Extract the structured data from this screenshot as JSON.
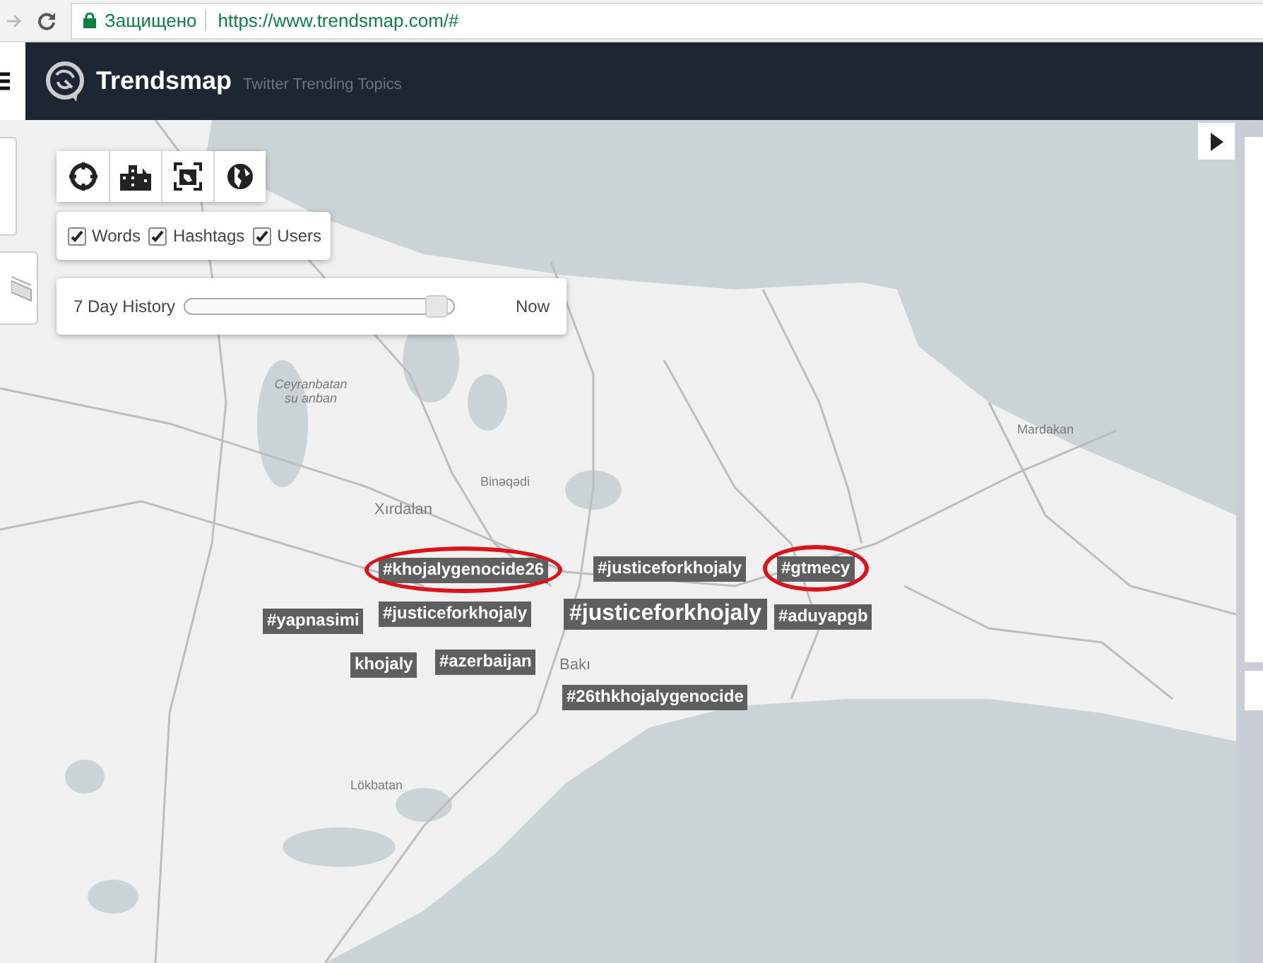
{
  "browser": {
    "security": "Защищено",
    "url": "https://www.trendsmap.com/#"
  },
  "header": {
    "brand": "Trendsmap",
    "tagline": "Twitter Trending Topics"
  },
  "filters": [
    {
      "label": "Words",
      "checked": true
    },
    {
      "label": "Hashtags",
      "checked": true
    },
    {
      "label": "Users",
      "checked": true
    }
  ],
  "history": {
    "label": "7 Day History",
    "level": 0.97,
    "end_label": "Now"
  },
  "map_labels": [
    {
      "text": "Ceyranbatan su anban",
      "kind": "area"
    },
    {
      "text": "Xırdalan",
      "kind": "city"
    },
    {
      "text": "Binəqədi",
      "kind": "town"
    },
    {
      "text": "Mardakan",
      "kind": "town"
    },
    {
      "text": "Bakı",
      "kind": "city"
    },
    {
      "text": "Lökbatan",
      "kind": "town"
    }
  ],
  "tags": [
    {
      "text": "#khojalygenocide26",
      "kind": "normal",
      "circled": true
    },
    {
      "text": "#justiceforkhojaly",
      "kind": "normal",
      "circled": false
    },
    {
      "text": "#gtmecy",
      "kind": "normal",
      "circled": true
    },
    {
      "text": "#yapnasimi",
      "kind": "normal",
      "circled": false
    },
    {
      "text": "#justiceforkhojaly",
      "kind": "normal",
      "circled": false
    },
    {
      "text": "#justiceforkhojaly",
      "kind": "large",
      "circled": false
    },
    {
      "text": "#aduyapgb",
      "kind": "normal",
      "circled": false
    },
    {
      "text": "khojaly",
      "kind": "normal",
      "circled": false
    },
    {
      "text": "#azerbaijan",
      "kind": "normal",
      "circled": false
    },
    {
      "text": "#26thkhojalygenocide",
      "kind": "normal",
      "circled": false
    }
  ]
}
